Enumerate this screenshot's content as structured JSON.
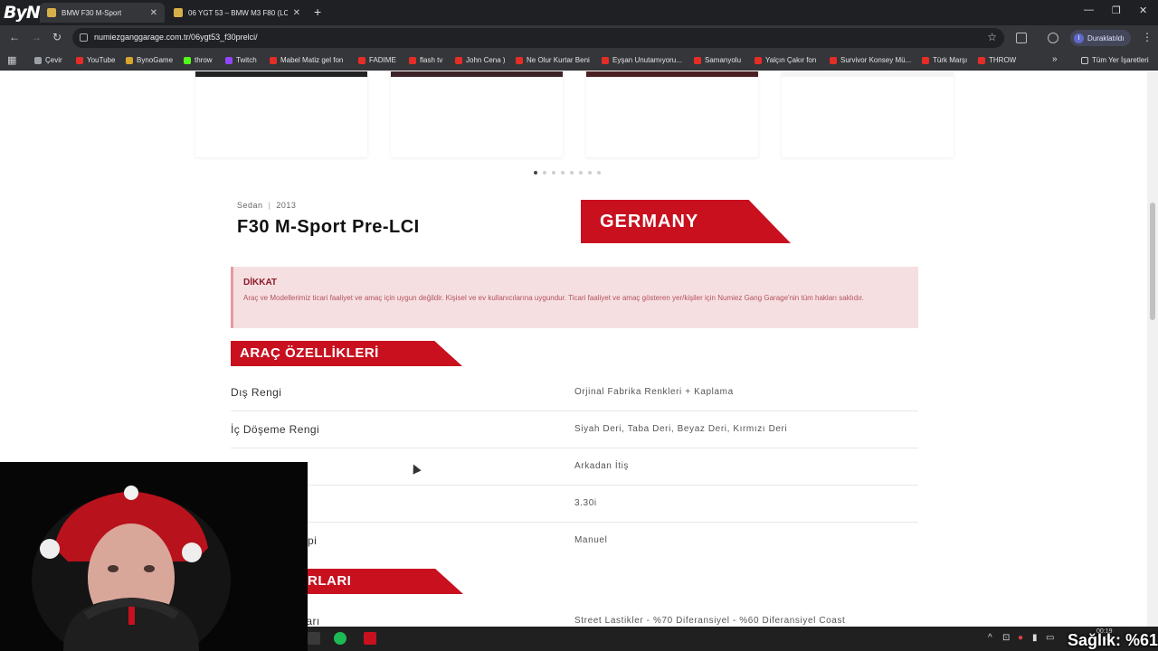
{
  "browser": {
    "tabs": [
      {
        "label": "BMW F30 M-Sport",
        "active": true
      },
      {
        "label": "06 YGT 53 – BMW M3 F80 (LCI)",
        "active": false
      }
    ],
    "url": "numiezganggarage.com.tr/06ygt53_f30prelci/",
    "profile_initial": "I",
    "profile_label": "Duraklatıldı",
    "bookmarks": [
      {
        "label": "Çevir",
        "icon": "translate-icon"
      },
      {
        "label": "YouTube",
        "icon": "youtube-icon"
      },
      {
        "label": "BynoGame",
        "icon": "site-icon"
      },
      {
        "label": "throw",
        "icon": "kick-icon"
      },
      {
        "label": "Twitch",
        "icon": "twitch-icon"
      },
      {
        "label": "Mabel Matiz  gel fon",
        "icon": "youtube-icon"
      },
      {
        "label": "FADIME",
        "icon": "youtube-icon"
      },
      {
        "label": "flash tv",
        "icon": "youtube-icon"
      },
      {
        "label": "John Cena )",
        "icon": "youtube-icon"
      },
      {
        "label": "Ne Olur Kurtar Beni",
        "icon": "youtube-icon"
      },
      {
        "label": "Eyşan Unutamıyoru...",
        "icon": "youtube-icon"
      },
      {
        "label": "Samanyolu",
        "icon": "youtube-icon"
      },
      {
        "label": "Yalçın Çakır  fon",
        "icon": "youtube-icon"
      },
      {
        "label": "Survivor Konsey Mü...",
        "icon": "youtube-icon"
      },
      {
        "label": "Türk Marşı",
        "icon": "youtube-icon"
      },
      {
        "label": "THROW",
        "icon": "youtube-icon"
      }
    ],
    "all_bookmarks": "Tüm Yer İşaretleri",
    "watermark": "ByNo"
  },
  "vehicle": {
    "category": "Sedan",
    "year": "2013",
    "title": "F30 M-Sport Pre-LCI",
    "country": "GERMANY"
  },
  "notice": {
    "heading": "DİKKAT",
    "text": "Araç ve Modellerimiz ticari faaliyet ve amaç için uygun değildir. Kişisel ve ev kullanıcılarına uygundur. Ticari faaliyet ve amaç gösteren yer/kişiler için Numiez Gang Garage'nin tüm hakları saklıdır."
  },
  "features": {
    "heading": "ARAÇ ÖZELLİKLERİ",
    "rows": [
      {
        "key": "Dış Rengi",
        "value": "Orjinal Fabrika Renkleri + Kaplama"
      },
      {
        "key": "İç Döşeme Rengi",
        "value": "Siyah Deri, Taba Deri, Beyaz Deri, Kırmızı Deri"
      },
      {
        "key": "",
        "value": "Arkadan İtiş"
      },
      {
        "key": "",
        "value": "3.30i"
      },
      {
        "key": "pi",
        "value": "Manuel"
      }
    ]
  },
  "settings": {
    "heading_partial": "RLARI",
    "row_key_partial": "t Ayarı",
    "row_value": "Street Lastikler - %70 Diferansiyel - %60 Diferansiyel Coast"
  },
  "carousel": {
    "dots": 8,
    "active_index": 0
  },
  "taskbar": {
    "time": "00:19",
    "date": "…26",
    "overlay": "Sağlık: %61"
  },
  "colors": {
    "accent": "#c8101f",
    "notice_bg": "#f6dfe1"
  }
}
